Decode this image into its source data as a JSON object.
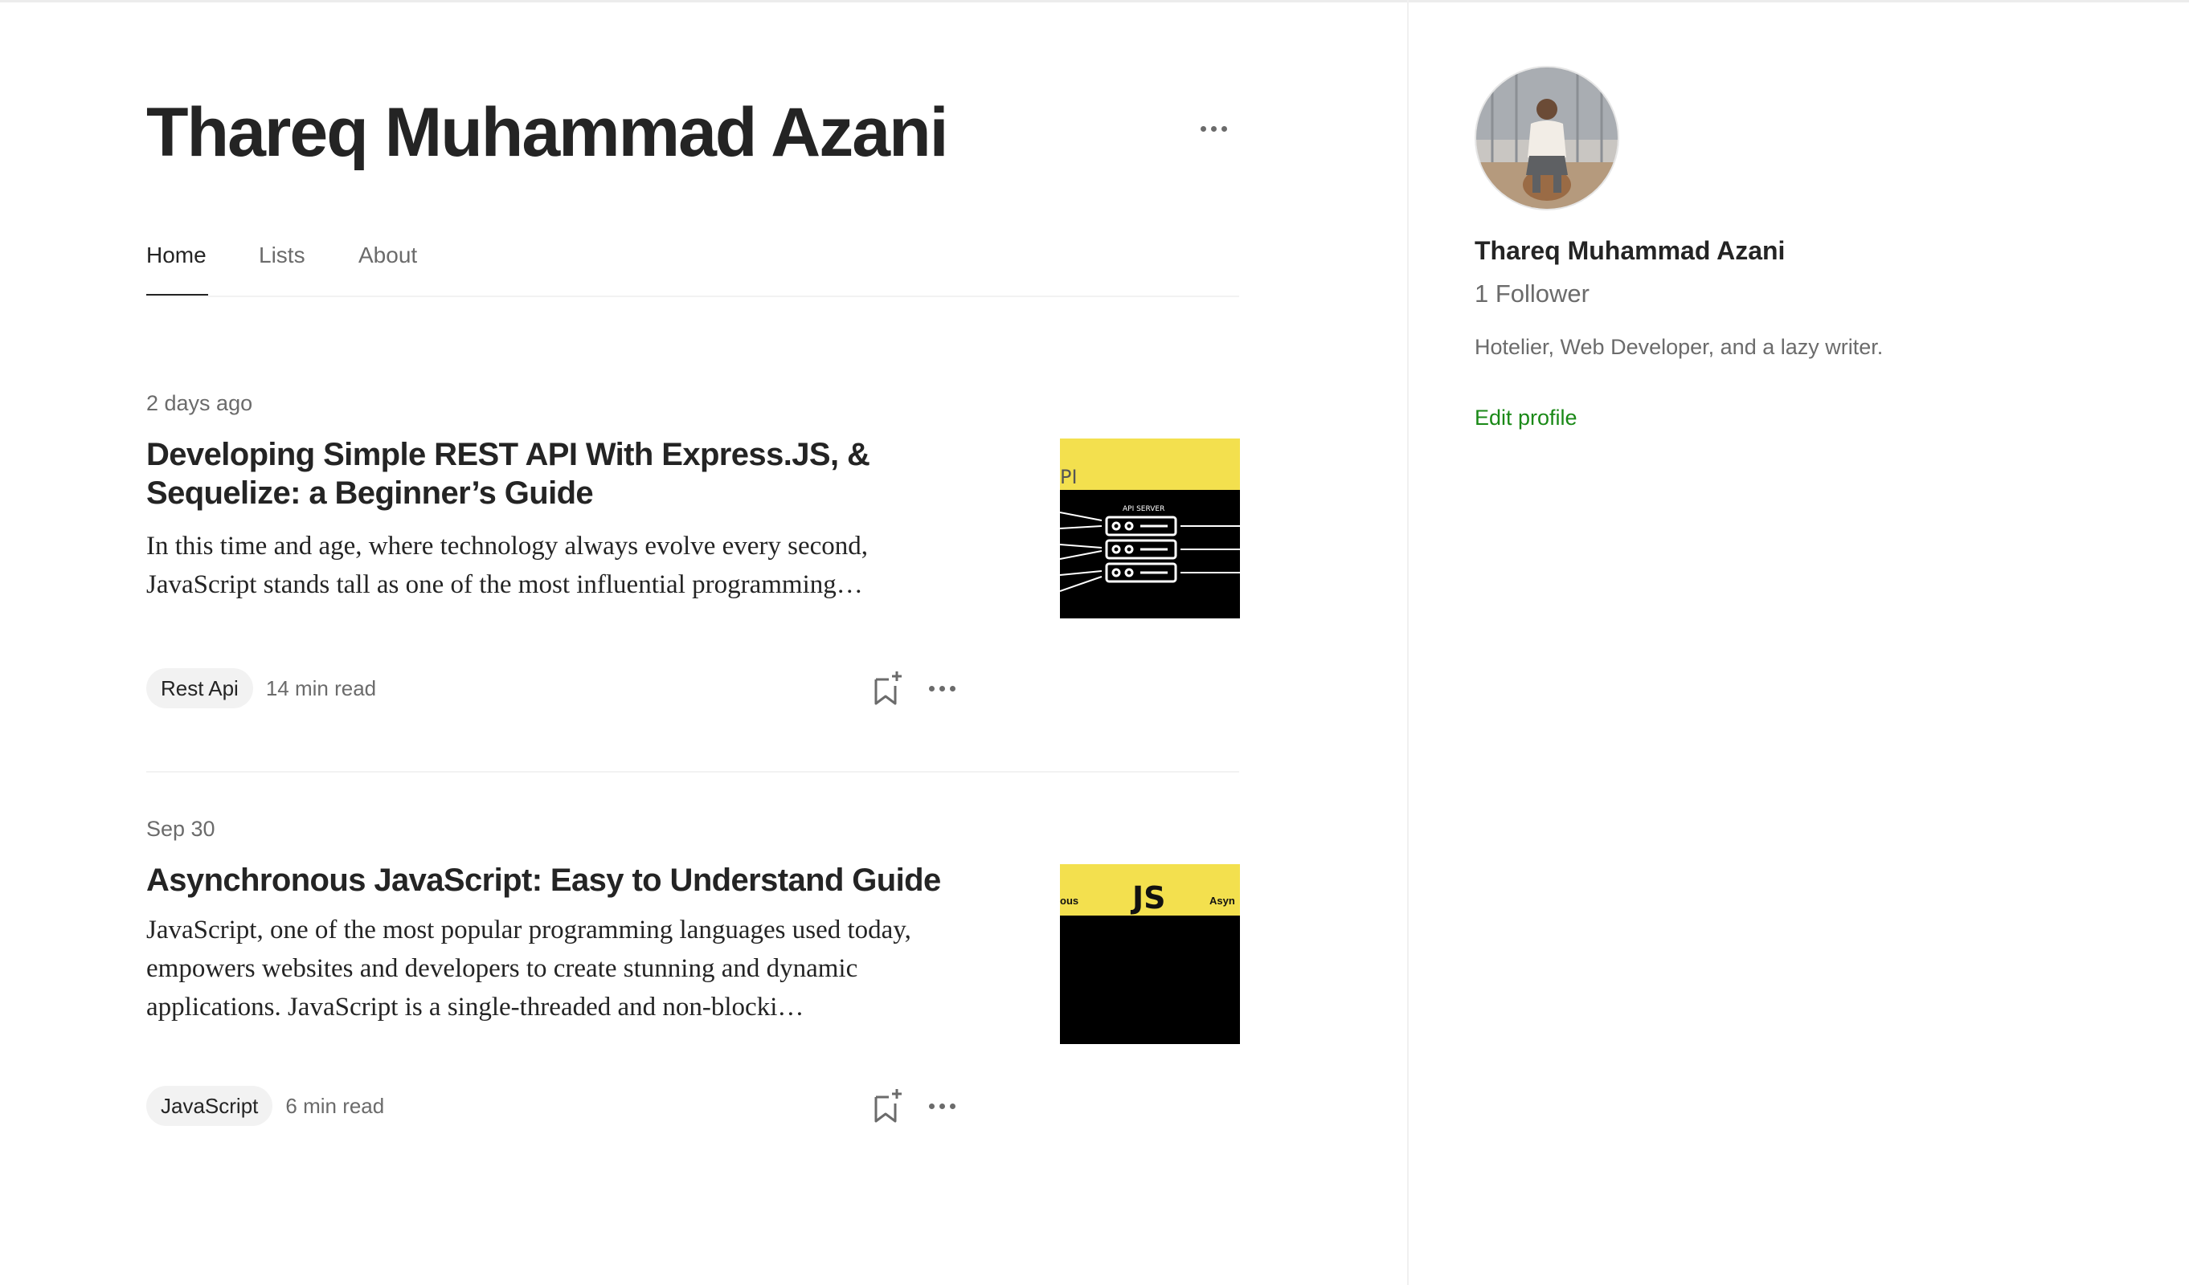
{
  "header": {
    "title": "Thareq Muhammad Azani",
    "more_icon": "more-horizontal-icon"
  },
  "tabs": [
    {
      "label": "Home",
      "active": true
    },
    {
      "label": "Lists",
      "active": false
    },
    {
      "label": "About",
      "active": false
    }
  ],
  "articles": [
    {
      "date": "2 days ago",
      "title": "Developing Simple REST API With Express.JS, & Sequelize: a Beginner’s Guide",
      "excerpt": "In this time and age, where technology always evolve every second, JavaScript stands tall as one of the most influential programming…",
      "tag": "Rest Api",
      "read_time": "14 min read",
      "thumbnail": {
        "band_text": "PI",
        "diagram_label": "API SERVER"
      }
    },
    {
      "date": "Sep 30",
      "title": "Asynchronous JavaScript: Easy to Understand Guide",
      "excerpt": "JavaScript, one of the most popular programming languages used today, empowers websites and developers to create stunning and dynamic applications. JavaScript is a single-threaded and non-blocki…",
      "tag": "JavaScript",
      "read_time": "6 min read",
      "thumbnail": {
        "band_left": "ous",
        "band_center": "JS",
        "band_right": "Asyn"
      }
    }
  ],
  "sidebar": {
    "name": "Thareq Muhammad Azani",
    "followers": "1 Follower",
    "bio": "Hotelier, Web Developer, and a lazy writer.",
    "edit_profile": "Edit profile"
  },
  "colors": {
    "text": "#242424",
    "muted": "#6b6b6b",
    "accent_green": "#1a8917",
    "thumb_yellow": "#f3e04e"
  }
}
